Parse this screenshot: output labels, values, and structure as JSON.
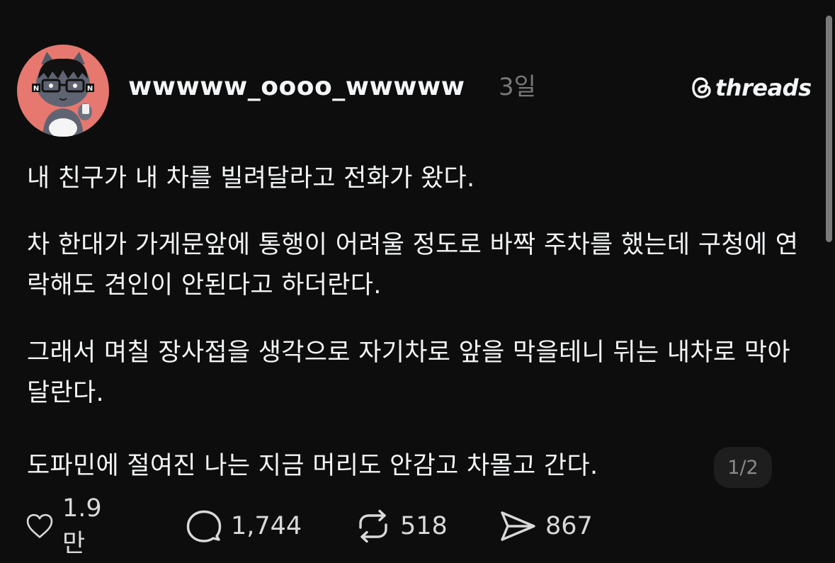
{
  "post": {
    "username": "wwwww_oooo_wwwww",
    "time": "3일",
    "brand": "threads",
    "paragraphs": [
      "내 친구가 내 차를 빌려달라고 전화가 왔다.",
      "차 한대가 가게문앞에 통행이 어려울 정도로 바짝 주차를 했는데 구청에 연락해도 견인이 안된다고 하더란다.",
      "그래서 며칠 장사접을 생각으로 자기차로 앞을 막을테니 뒤는 내차로 막아달란다.",
      "도파민에 절여진 나는 지금 머리도 안감고 차몰고 간다."
    ],
    "pager": "1/2"
  },
  "actions": {
    "like": {
      "icon": "heart-icon",
      "count": "1.9만"
    },
    "reply": {
      "icon": "comment-icon",
      "count": "1,744"
    },
    "repost": {
      "icon": "repost-icon",
      "count": "518"
    },
    "share": {
      "icon": "send-icon",
      "count": "867"
    }
  },
  "colors": {
    "background": "#0d0d0d",
    "text": "#f3f5f7",
    "muted": "#777777",
    "avatar_bg": "#e67870"
  }
}
